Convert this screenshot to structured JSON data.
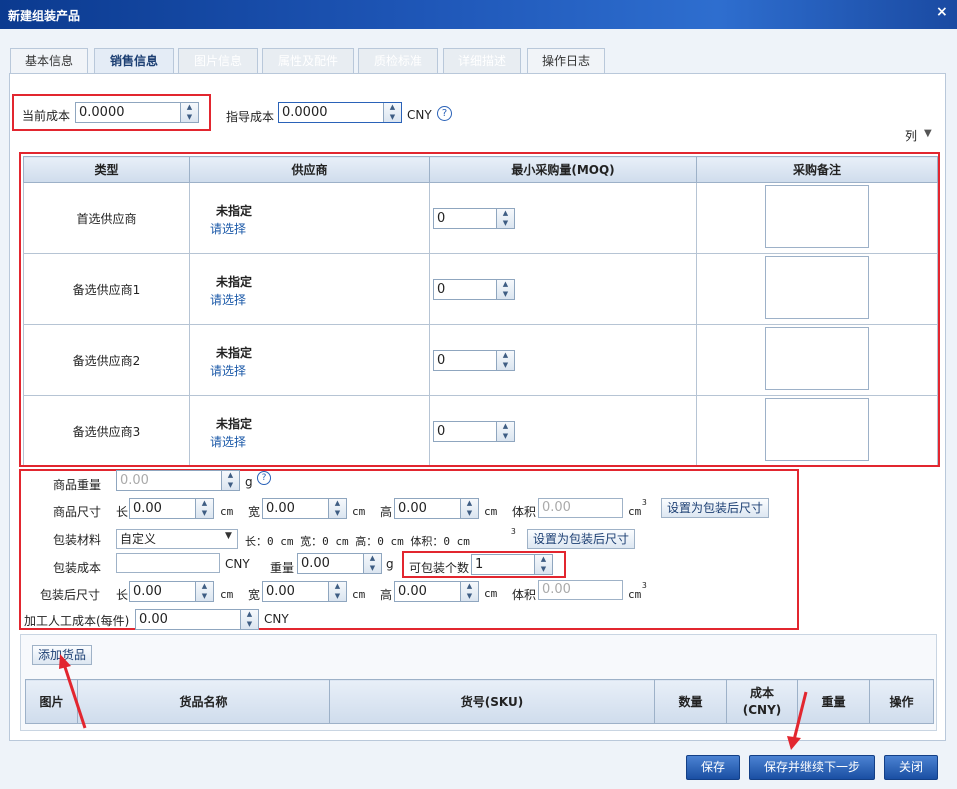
{
  "window": {
    "title": "新建组装产品",
    "close": "×"
  },
  "tabs": [
    {
      "label": "基本信息",
      "state": "normal"
    },
    {
      "label": "销售信息",
      "state": "active"
    },
    {
      "label": "图片信息",
      "state": "disabled"
    },
    {
      "label": "属性及配件",
      "state": "disabled"
    },
    {
      "label": "质检标准",
      "state": "disabled"
    },
    {
      "label": "详细描述",
      "state": "disabled"
    },
    {
      "label": "操作日志",
      "state": "normal"
    }
  ],
  "cost": {
    "current_label": "当前成本",
    "current_value": "0.0000",
    "guide_label": "指导成本",
    "guide_value": "0.0000",
    "currency": "CNY",
    "help": "?"
  },
  "columns_menu": "列",
  "supplier_table": {
    "headers": [
      "类型",
      "供应商",
      "最小采购量(MOQ)",
      "采购备注"
    ],
    "rows": [
      {
        "type": "首选供应商",
        "supplier": "未指定",
        "pick": "请选择",
        "moq": "0"
      },
      {
        "type": "备选供应商1",
        "supplier": "未指定",
        "pick": "请选择",
        "moq": "0"
      },
      {
        "type": "备选供应商2",
        "supplier": "未指定",
        "pick": "请选择",
        "moq": "0"
      },
      {
        "type": "备选供应商3",
        "supplier": "未指定",
        "pick": "请选择",
        "moq": "0"
      }
    ]
  },
  "goods": {
    "weight_label": "商品重量",
    "weight_value": "0.00",
    "weight_unit": "g",
    "size_label": "商品尺寸",
    "len_label": "长",
    "len_value": "0.00",
    "wid_label": "宽",
    "wid_value": "0.00",
    "hei_label": "高",
    "hei_value": "0.00",
    "cm": "cm",
    "vol_label": "体积",
    "vol_value": "0.00",
    "cm3": "cm",
    "sup3": "3",
    "set_pack_size": "设置为包装后尺寸",
    "material_label": "包装材料",
    "material_value": "自定义",
    "material_dims": "长：0 cm   宽：0 cm   高：0 cm   体积：0 cm",
    "pack_cost_label": "包装成本",
    "pack_cost_value": "",
    "currency": "CNY",
    "pack_weight_label": "重量",
    "pack_weight_value": "0.00",
    "pack_count_label": "可包装个数",
    "pack_count_value": "1",
    "pack_size_label": "包装后尺寸",
    "pack_len_value": "0.00",
    "pack_wid_value": "0.00",
    "pack_hei_value": "0.00",
    "pack_vol_value": "0.00",
    "labor_label": "加工人工成本(每件)",
    "labor_value": "0.00"
  },
  "add_goods_button": "添加货品",
  "goods_table": {
    "headers": [
      "图片",
      "货品名称",
      "货号(SKU)",
      "数量",
      "成本\n(CNY)",
      "重量",
      "操作"
    ]
  },
  "buttons": {
    "save": "保存",
    "save_next": "保存并继续下一步",
    "close": "关闭"
  },
  "colors": {
    "titlebar": "#1f57b8",
    "highlight_red": "#e2262f",
    "button_blue": "#2a62b8"
  }
}
